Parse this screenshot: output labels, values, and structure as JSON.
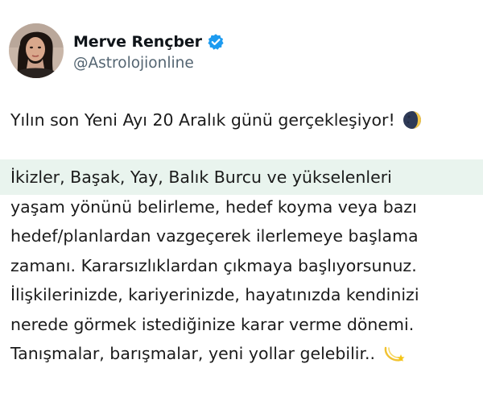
{
  "author": {
    "display_name": "Merve Rençber",
    "handle": "@Astrolojionline",
    "verified_color": "#1d9bf0"
  },
  "tweet": {
    "first_line": "Yılın son Yeni Ayı 20 Aralık günü gerçekleşiyor!",
    "first_line_icon": "new-moon-emoji",
    "body_lines": [
      "İkizler, Başak, Yay, Balık Burcu ve yükselenleri",
      "yaşam yönünü belirleme, hedef koyma veya bazı",
      "hedef/planlardan vazgeçerek ilerlemeye başlama",
      "zamanı. Kararsızlıklardan çıkmaya başlıyorsunuz.",
      "İlişkilerinizde, kariyerinizde, hayatınızda kendinizi",
      "nerede görmek istediğinize karar verme dönemi.",
      "Tanışmalar, barışmalar, yeni yollar gelebilir.."
    ],
    "last_line_icon": "dizzy-comet-emoji",
    "highlight_color": "#e9f4ee"
  }
}
